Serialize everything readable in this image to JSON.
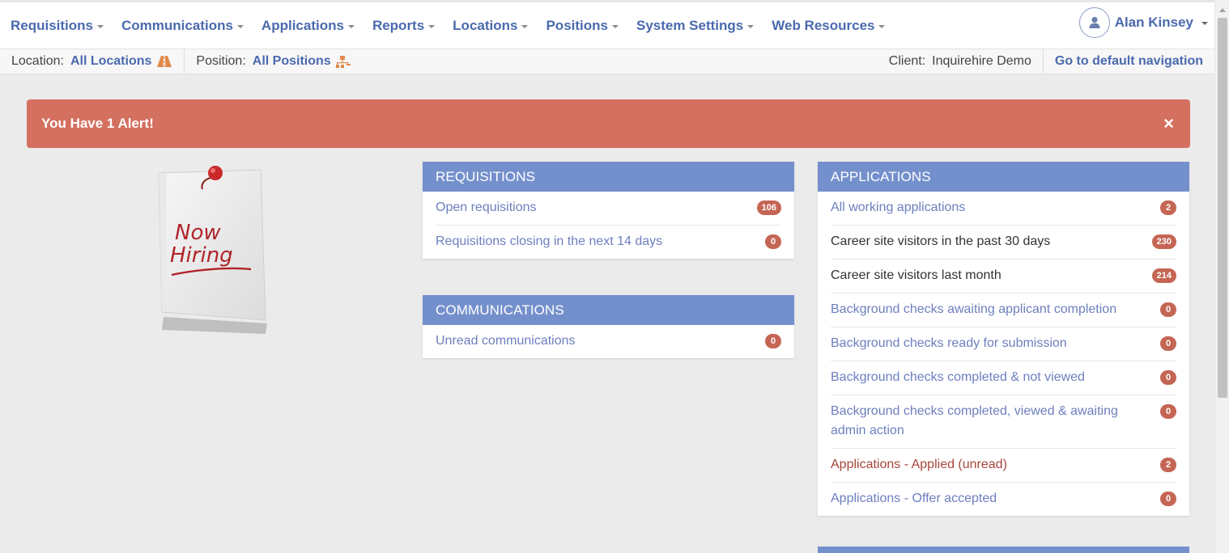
{
  "nav": {
    "items": [
      {
        "label": "Requisitions",
        "name": "nav-requisitions"
      },
      {
        "label": "Communications",
        "name": "nav-communications"
      },
      {
        "label": "Applications",
        "name": "nav-applications"
      },
      {
        "label": "Reports",
        "name": "nav-reports"
      },
      {
        "label": "Locations",
        "name": "nav-locations"
      },
      {
        "label": "Positions",
        "name": "nav-positions"
      },
      {
        "label": "System Settings",
        "name": "nav-system-settings"
      },
      {
        "label": "Web Resources",
        "name": "nav-web-resources"
      }
    ],
    "user_name": "Alan Kinsey",
    "user_icon": "user-icon"
  },
  "context": {
    "location_label": "Location:",
    "location_value": "All Locations",
    "location_icon": "road-icon",
    "position_label": "Position:",
    "position_value": "All Positions",
    "position_icon": "sitemap-icon",
    "client_label": "Client:",
    "client_value": "Inquirehire Demo",
    "default_nav_link": "Go to default navigation"
  },
  "alert": {
    "text": "You Have 1 Alert!",
    "close_symbol": "×"
  },
  "note": {
    "line1": "Now",
    "line2": "Hiring"
  },
  "panels": {
    "requisitions": {
      "title": "REQUISITIONS",
      "rows": [
        {
          "label": "Open requisitions",
          "count": "106",
          "style": "link"
        },
        {
          "label": "Requisitions closing in the next 14 days",
          "count": "0",
          "style": "link"
        }
      ]
    },
    "communications": {
      "title": "COMMUNICATIONS",
      "rows": [
        {
          "label": "Unread communications",
          "count": "0",
          "style": "link"
        }
      ]
    },
    "applications": {
      "title": "APPLICATIONS",
      "rows": [
        {
          "label": "All working applications",
          "count": "2",
          "style": "link"
        },
        {
          "label": "Career site visitors in the past 30 days",
          "count": "230",
          "style": "plain"
        },
        {
          "label": "Career site visitors last month",
          "count": "214",
          "style": "plain"
        },
        {
          "label": "Background checks awaiting applicant completion",
          "count": "0",
          "style": "link"
        },
        {
          "label": "Background checks ready for submission",
          "count": "0",
          "style": "link"
        },
        {
          "label": "Background checks completed & not viewed",
          "count": "0",
          "style": "link"
        },
        {
          "label": "Background checks completed, viewed & awaiting admin action",
          "count": "0",
          "style": "link"
        },
        {
          "label": "Applications - Applied (unread)",
          "count": "2",
          "style": "alertlink"
        },
        {
          "label": "Applications - Offer accepted",
          "count": "0",
          "style": "link"
        }
      ]
    }
  },
  "colors": {
    "nav_link": "#4a6aae",
    "alert_bg": "#d47060",
    "panel_header": "#7490cc",
    "badge": "#c56655",
    "row_link": "#6d7fbf",
    "row_alert_link": "#a8453a"
  }
}
